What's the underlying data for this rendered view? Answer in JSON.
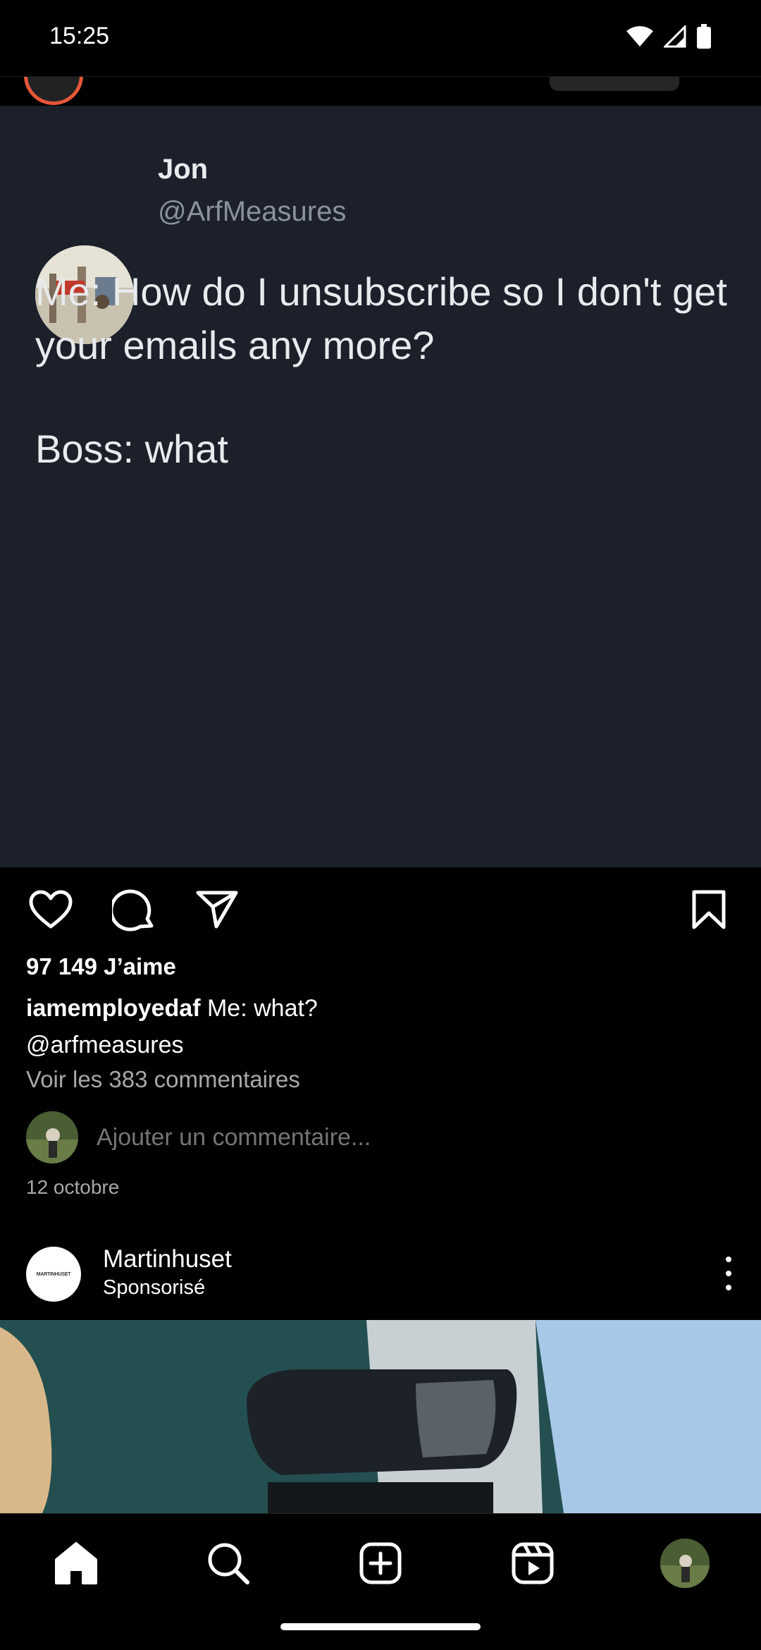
{
  "status_bar": {
    "time": "15:25"
  },
  "post": {
    "tweet": {
      "name": "Jon",
      "handle": "@ArfMeasures",
      "text_line1": "Me: How do I unsubscribe so I don't get your emails any more?",
      "text_line2": "Boss: what"
    },
    "likes": "97 149 J’aime",
    "caption_user": "iamemployedaf",
    "caption_text": "Me: what?",
    "caption_mention": "@arfmeasures",
    "view_comments": "Voir les 383 commentaires",
    "comment_placeholder": "Ajouter un commentaire...",
    "date": "12 octobre"
  },
  "next_post": {
    "user": "Martinhuset",
    "label": "Sponsorisé",
    "avatar_text": "MARTINHUSET"
  },
  "colors": {
    "background": "#000000",
    "post_image_bg": "#1b202b",
    "muted_text": "#a8a8a8"
  },
  "icons": [
    "home-icon",
    "search-icon",
    "create-icon",
    "reels-icon",
    "heart-icon",
    "comment-icon",
    "share-icon",
    "bookmark-icon",
    "wifi-icon",
    "signal-icon",
    "battery-icon",
    "more-icon"
  ]
}
